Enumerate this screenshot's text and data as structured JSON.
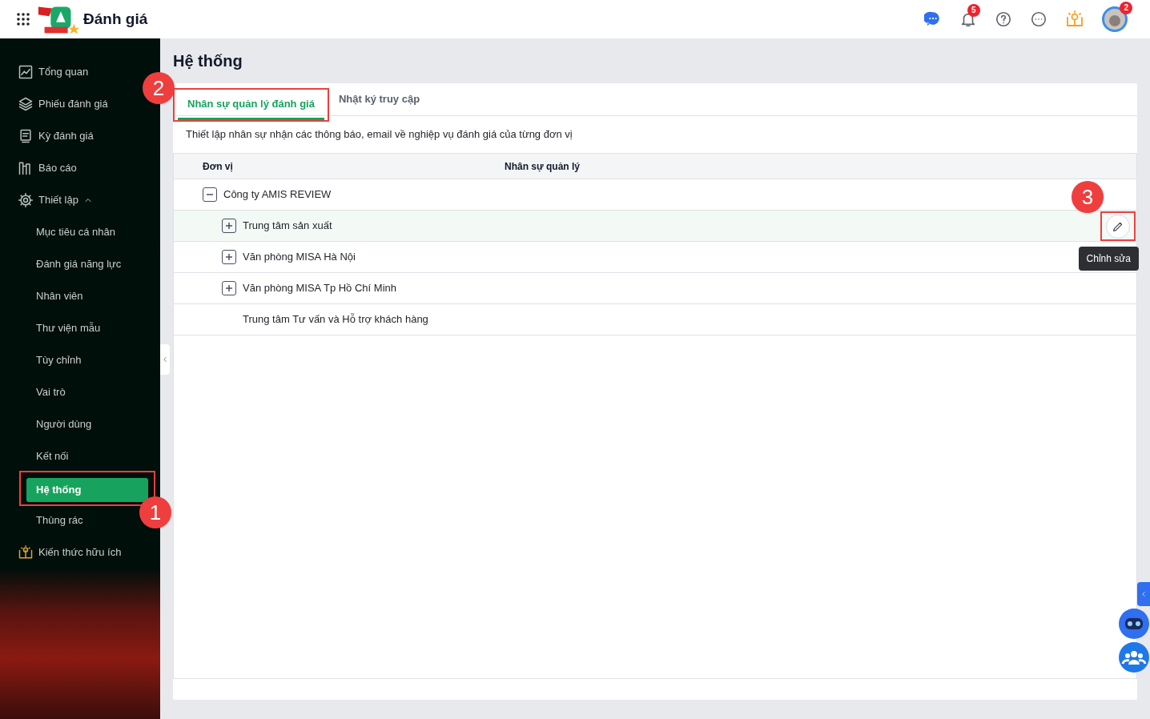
{
  "header": {
    "app_title": "Đánh giá",
    "notification_count": "5",
    "avatar_badge": "2"
  },
  "sidebar": {
    "items": [
      {
        "kind": "top",
        "label": "Tổng quan",
        "selected": false
      },
      {
        "kind": "top",
        "label": "Phiếu đánh giá",
        "selected": false
      },
      {
        "kind": "top",
        "label": "Kỳ đánh giá",
        "selected": false
      },
      {
        "kind": "top",
        "label": "Báo cáo",
        "selected": false
      },
      {
        "kind": "top",
        "label": "Thiết lập",
        "selected": false,
        "expanded": true
      },
      {
        "kind": "sub",
        "label": "Mục tiêu cá nhân",
        "selected": false
      },
      {
        "kind": "sub",
        "label": "Đánh giá năng lực",
        "selected": false
      },
      {
        "kind": "sub",
        "label": "Nhân viên",
        "selected": false
      },
      {
        "kind": "sub",
        "label": "Thư viện mẫu",
        "selected": false
      },
      {
        "kind": "sub",
        "label": "Tùy chỉnh",
        "selected": false
      },
      {
        "kind": "sub",
        "label": "Vai trò",
        "selected": false
      },
      {
        "kind": "sub",
        "label": "Người dùng",
        "selected": false
      },
      {
        "kind": "sub",
        "label": "Kết nối",
        "selected": false
      },
      {
        "kind": "sub",
        "label": "Hệ thống",
        "selected": true,
        "callout": "1"
      },
      {
        "kind": "sub",
        "label": "Thùng rác",
        "selected": false
      },
      {
        "kind": "top",
        "label": "Kiến thức hữu ích",
        "selected": false
      }
    ]
  },
  "page": {
    "title": "Hệ thống",
    "tabs": [
      {
        "label": "Nhân sự quản lý đánh giá",
        "selected": true,
        "callout": "2"
      },
      {
        "label": "Nhật ký truy cập",
        "selected": false
      }
    ],
    "description": "Thiết lập nhân sự nhận các thông báo, email về nghiệp vụ đánh giá của từng đơn vị",
    "table": {
      "columns": [
        "Đơn vị",
        "Nhân sự quản lý"
      ],
      "rows": [
        {
          "name": "Công ty AMIS REVIEW",
          "expanded": true,
          "highlighted": false,
          "children": [
            {
              "name": "Trung tâm sản xuất",
              "expanded": false,
              "highlighted": true,
              "edit": {
                "tooltip": "Chỉnh sửa",
                "callout": "3"
              }
            },
            {
              "name": "Văn phòng MISA Hà Nội",
              "expanded": false,
              "highlighted": false
            },
            {
              "name": "Văn phòng MISA Tp Hồ Chí Minh",
              "expanded": false,
              "highlighted": false
            },
            {
              "name": "Trung tâm Tư vấn và Hỗ trợ khách hàng",
              "highlighted": false
            }
          ]
        }
      ]
    }
  }
}
